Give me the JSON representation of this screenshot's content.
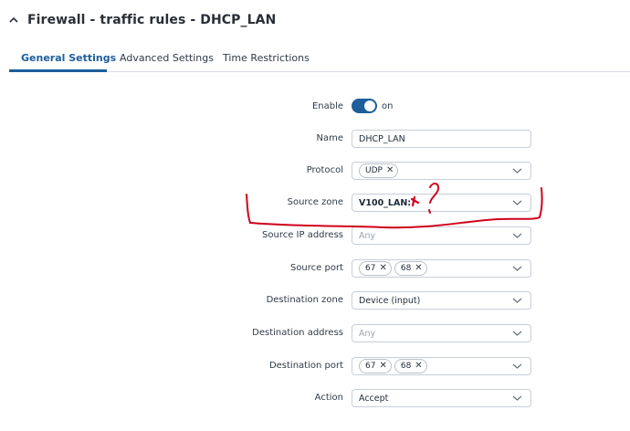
{
  "header": {
    "title": "Firewall - traffic rules - DHCP_LAN",
    "collapse_icon": "chevron-up-icon"
  },
  "tabs": [
    {
      "label": "General Settings",
      "active": true
    },
    {
      "label": "Advanced Settings",
      "active": false
    },
    {
      "label": "Time Restrictions",
      "active": false
    }
  ],
  "fields": {
    "enable": {
      "label": "Enable",
      "state": "on"
    },
    "name": {
      "label": "Name",
      "value": "DHCP_LAN"
    },
    "protocol": {
      "label": "Protocol",
      "chips": [
        "UDP"
      ]
    },
    "source_zone": {
      "label": "Source zone",
      "value": "V100_LAN:"
    },
    "source_ip": {
      "label": "Source IP address",
      "placeholder": "Any"
    },
    "source_port": {
      "label": "Source port",
      "chips": [
        "67",
        "68"
      ]
    },
    "dest_zone": {
      "label": "Destination zone",
      "value": "Device (input)"
    },
    "dest_address": {
      "label": "Destination address",
      "placeholder": "Any"
    },
    "dest_port": {
      "label": "Destination port",
      "chips": [
        "67",
        "68"
      ]
    },
    "action": {
      "label": "Action",
      "value": "Accept"
    }
  },
  "colors": {
    "accent": "#1d5e9b",
    "annotation": "#d0021b",
    "border": "#c7ced8"
  },
  "chip_remove_symbol": "✕"
}
